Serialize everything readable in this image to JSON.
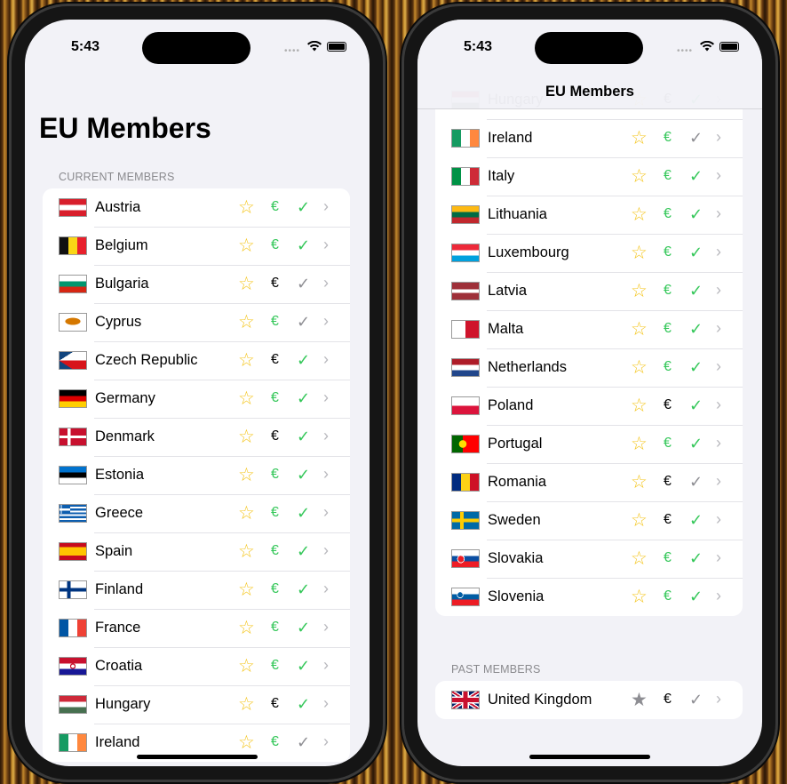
{
  "status": {
    "time": "5:43"
  },
  "screen1": {
    "title": "EU Members",
    "section_header": "CURRENT MEMBERS",
    "rows": [
      {
        "name": "Austria",
        "flag": "austria-flag",
        "favorite": false,
        "euro": true,
        "check": true
      },
      {
        "name": "Belgium",
        "flag": "belgium-flag",
        "favorite": false,
        "euro": true,
        "check": true
      },
      {
        "name": "Bulgaria",
        "flag": "bulgaria-flag",
        "favorite": false,
        "euro": false,
        "check": false
      },
      {
        "name": "Cyprus",
        "flag": "cyprus-flag",
        "favorite": false,
        "euro": true,
        "check": false
      },
      {
        "name": "Czech Republic",
        "flag": "czech-flag",
        "favorite": false,
        "euro": false,
        "check": true
      },
      {
        "name": "Germany",
        "flag": "germany-flag",
        "favorite": false,
        "euro": true,
        "check": true
      },
      {
        "name": "Denmark",
        "flag": "denmark-flag",
        "favorite": false,
        "euro": false,
        "check": true
      },
      {
        "name": "Estonia",
        "flag": "estonia-flag",
        "favorite": false,
        "euro": true,
        "check": true
      },
      {
        "name": "Greece",
        "flag": "greece-flag",
        "favorite": false,
        "euro": true,
        "check": true
      },
      {
        "name": "Spain",
        "flag": "spain-flag",
        "favorite": false,
        "euro": true,
        "check": true
      },
      {
        "name": "Finland",
        "flag": "finland-flag",
        "favorite": false,
        "euro": true,
        "check": true
      },
      {
        "name": "France",
        "flag": "france-flag",
        "favorite": false,
        "euro": true,
        "check": true
      },
      {
        "name": "Croatia",
        "flag": "croatia-flag",
        "favorite": false,
        "euro": true,
        "check": true
      },
      {
        "name": "Hungary",
        "flag": "hungary-flag",
        "favorite": false,
        "euro": false,
        "check": true
      },
      {
        "name": "Ireland",
        "flag": "ireland-flag",
        "favorite": false,
        "euro": true,
        "check": false
      }
    ]
  },
  "screen2": {
    "nav_title": "EU Members",
    "rows": [
      {
        "name": "Hungary",
        "flag": "hungary-flag",
        "favorite": false,
        "euro": false,
        "check": true
      },
      {
        "name": "Ireland",
        "flag": "ireland-flag",
        "favorite": false,
        "euro": true,
        "check": false
      },
      {
        "name": "Italy",
        "flag": "italy-flag",
        "favorite": false,
        "euro": true,
        "check": true
      },
      {
        "name": "Lithuania",
        "flag": "lithuania-flag",
        "favorite": false,
        "euro": true,
        "check": true
      },
      {
        "name": "Luxembourg",
        "flag": "luxembourg-flag",
        "favorite": false,
        "euro": true,
        "check": true
      },
      {
        "name": "Latvia",
        "flag": "latvia-flag",
        "favorite": false,
        "euro": true,
        "check": true
      },
      {
        "name": "Malta",
        "flag": "malta-flag",
        "favorite": false,
        "euro": true,
        "check": true
      },
      {
        "name": "Netherlands",
        "flag": "netherlands-flag",
        "favorite": false,
        "euro": true,
        "check": true
      },
      {
        "name": "Poland",
        "flag": "poland-flag",
        "favorite": false,
        "euro": false,
        "check": true
      },
      {
        "name": "Portugal",
        "flag": "portugal-flag",
        "favorite": false,
        "euro": true,
        "check": true
      },
      {
        "name": "Romania",
        "flag": "romania-flag",
        "favorite": false,
        "euro": false,
        "check": false
      },
      {
        "name": "Sweden",
        "flag": "sweden-flag",
        "favorite": false,
        "euro": false,
        "check": true
      },
      {
        "name": "Slovakia",
        "flag": "slovakia-flag",
        "favorite": false,
        "euro": true,
        "check": true
      },
      {
        "name": "Slovenia",
        "flag": "slovenia-flag",
        "favorite": false,
        "euro": true,
        "check": true
      }
    ],
    "past_header": "PAST MEMBERS",
    "past_rows": [
      {
        "name": "United Kingdom",
        "flag": "uk-flag",
        "favorite": true,
        "euro": false,
        "check": false
      }
    ]
  },
  "glyphs": {
    "star_empty": "☆",
    "star_filled": "★",
    "euro": "€",
    "check": "✓",
    "chevron": "›"
  },
  "colors": {
    "star": "#f4c51c",
    "green": "#34c759",
    "gray": "#8e8e93"
  }
}
